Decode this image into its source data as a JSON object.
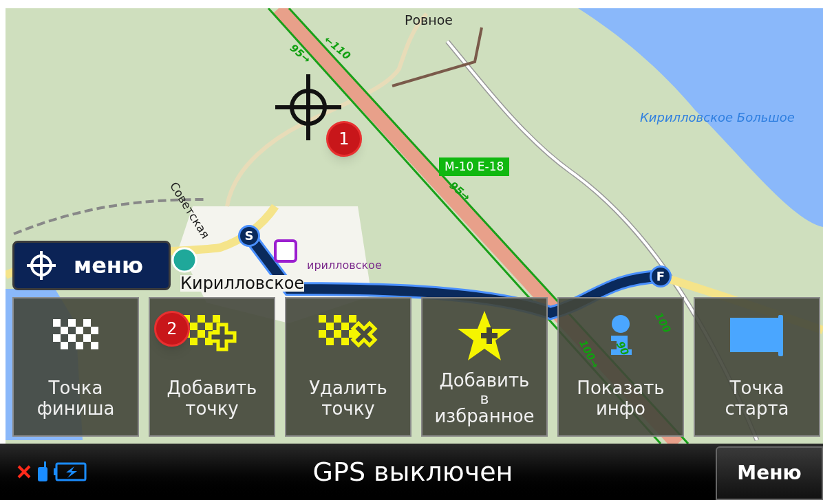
{
  "map": {
    "labels": [
      {
        "text": "Ровное",
        "kind": "place"
      },
      {
        "text": "Кирилловское Большое",
        "kind": "water"
      },
      {
        "text": "Советская",
        "kind": "street"
      },
      {
        "text": "Кирилловское",
        "kind": "town"
      },
      {
        "text": "ирилловское",
        "kind": "station"
      }
    ],
    "road_shield": "M-10 E-18",
    "speed_limits": [
      "95→",
      "←110",
      "95→",
      "100→",
      "90",
      "100"
    ],
    "markers": [
      "1",
      "2"
    ],
    "route": {
      "start": "S",
      "finish": "F"
    }
  },
  "menu_button": "меню",
  "actions": [
    {
      "kind": "finish",
      "lines": [
        "Точка",
        "финиша"
      ]
    },
    {
      "kind": "add_point",
      "lines": [
        "Добавить",
        "точку"
      ]
    },
    {
      "kind": "remove_point",
      "lines": [
        "Удалить",
        "точку"
      ]
    },
    {
      "kind": "favorite",
      "lines": [
        "Добавить",
        "в",
        "избранное"
      ]
    },
    {
      "kind": "info",
      "lines": [
        "Показать",
        "инфо"
      ]
    },
    {
      "kind": "start",
      "lines": [
        "Точка",
        "старта"
      ]
    }
  ],
  "status_bar": {
    "message": "GPS выключен",
    "menu": "Меню"
  }
}
